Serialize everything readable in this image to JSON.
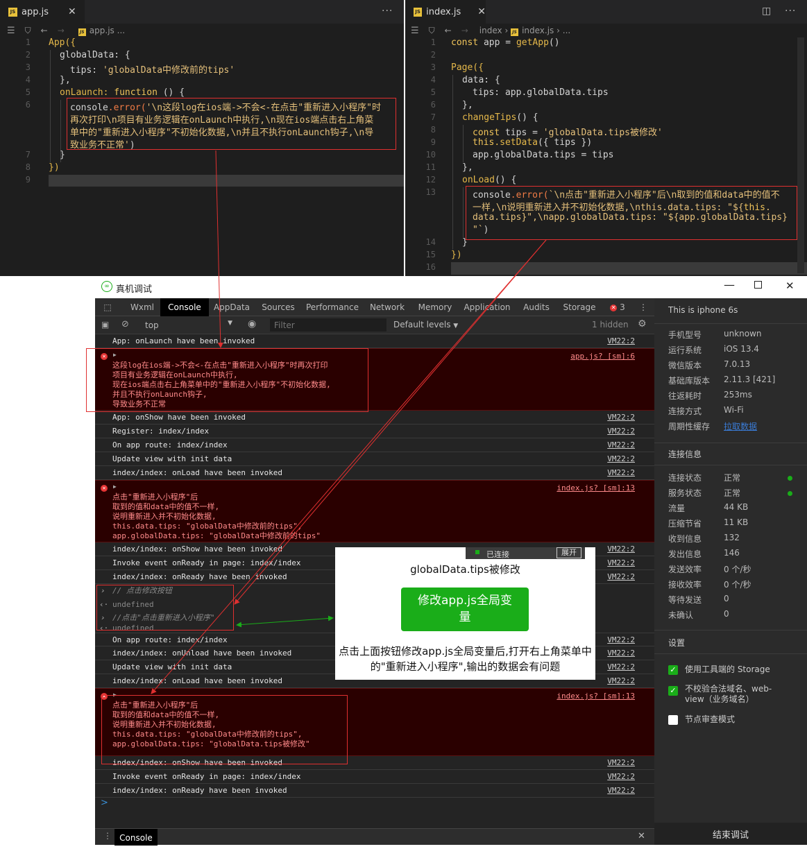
{
  "editor_left": {
    "tab": "app.js",
    "file_icon": "JS",
    "more": "···",
    "breadcrumb": [
      "app.js",
      "..."
    ],
    "line_numbers": [
      "1",
      "2",
      "3",
      "4",
      "5",
      "6",
      "7",
      "8",
      "9"
    ],
    "code": {
      "l1a": "App({",
      "l2a": "globalData: {",
      "l3a": "tips: ",
      "l3b": "'globalData中修改前的tips'",
      "l4a": "},",
      "l5a": "onLaunch: ",
      "l5b": "function",
      "l5c": " () {",
      "l6a": "console",
      "l6b": ".error(",
      "l6c": "'\\n这段log在ios端->不会<-在点击\"重新进入小程序\"时",
      "l6d": "再次打印\\n项目有业务逻辑在onLaunch中执行,\\n现在ios端点击右上角菜",
      "l6e": "单中的\"重新进入小程序\"不初始化数据,\\n并且不执行onLaunch钩子,\\n导",
      "l6f": "致业务不正常'",
      "l6g": ")",
      "l7a": "}",
      "l8a": "})"
    }
  },
  "editor_right": {
    "tab": "index.js",
    "file_icon": "JS",
    "more": "···",
    "breadcrumb": [
      "index",
      "index.js",
      "..."
    ],
    "line_numbers": [
      "1",
      "2",
      "3",
      "4",
      "5",
      "6",
      "7",
      "8",
      "9",
      "10",
      "11",
      "12",
      "13",
      "14",
      "15",
      "16"
    ],
    "code": {
      "l1a": "const",
      "l1b": " app = ",
      "l1c": "getApp",
      "l1d": "()",
      "l3a": "Page({",
      "l4a": "data: {",
      "l5a": "tips: app.globalData.tips",
      "l6a": "},",
      "l7a": "changeTips",
      "l7b": "() {",
      "l8a": "const",
      "l8b": " tips = ",
      "l8c": "'globalData.tips被修改'",
      "l9a": "this",
      "l9b": ".setData",
      "l9c": "({ tips })",
      "l10a": "app.globalData.tips = tips",
      "l11a": "},",
      "l12a": "onLoad",
      "l12b": "() {",
      "l13a": "console",
      "l13b": ".error(",
      "l13c": "`\\n点击\"重新进入小程序\"后\\n取到的值和data中的值不",
      "l13d": "一样,\\n说明重新进入并不初始化数据,\\nthis.data.tips: \"${",
      "l13e": "this",
      "l13f": ".",
      "l13g": "data.tips}\",\\napp.globalData.tips: \"${app.globalData.tips}",
      "l13h": "\"`",
      "l13i": ")",
      "l14a": "}",
      "l15a": "})"
    }
  },
  "debugger": {
    "title": "真机调试",
    "tabs": [
      "Wxml",
      "Console",
      "AppData",
      "Sources",
      "Performance",
      "Network",
      "Memory",
      "Application",
      "Audits",
      "Storage"
    ],
    "error_count": "3",
    "context": "top",
    "filter_placeholder": "Filter",
    "levels": "Default levels",
    "hidden": "1 hidden",
    "logs": {
      "r1": "App: onLaunch have been invoked",
      "r1s": "VM22:2",
      "e1s": "app.js? [sm]:6",
      "e1": "这段log在ios端->不会<-在点击\"重新进入小程序\"时再次打印\n项目有业务逻辑在onLaunch中执行,\n现在ios端点击右上角菜单中的\"重新进入小程序\"不初始化数据,\n并且不执行onLaunch钩子,\n导致业务不正常",
      "r2": "App: onShow have been invoked",
      "r3": "Register: index/index",
      "r4": "On app route: index/index",
      "r5": "Update view with init data",
      "r6": "index/index: onLoad have been invoked",
      "e2s": "index.js? [sm]:13",
      "e2": "点击\"重新进入小程序\"后\n取到的值和data中的值不一样,\n说明重新进入并不初始化数据,\nthis.data.tips: \"globalData中修改前的tips\",\napp.globalData.tips: \"globalData中修改前的tips\"",
      "r7": "index/index: onShow have been invoked",
      "r8": "Invoke event onReady in page: index/index",
      "r9": "index/index: onReady have been invoked",
      "c1": "// 点击修改按钮",
      "u1": "undefined",
      "c2": "//点击\"点击重新进入小程序\"",
      "u2": "undefined",
      "r10": "On app route: index/index",
      "r11": "index/index: onUnload have been invoked",
      "r12": "Update view with init data",
      "r13": "index/index: onLoad have been invoked",
      "e3s": "index.js? [sm]:13",
      "e3": "点击\"重新进入小程序\"后\n取到的值和data中的值不一样,\n说明重新进入并不初始化数据,\nthis.data.tips: \"globalData中修改前的tips\",\napp.globalData.tips: \"globalData.tips被修改\"",
      "r14": "index/index: onShow have been invoked",
      "r15": "Invoke event onReady in page: index/index",
      "r16": "index/index: onReady have been invoked"
    },
    "vm": "VM22:2",
    "prompt": ">",
    "bottom_tab": "Console",
    "side": {
      "device": "This is iphone 6s",
      "info": [
        {
          "k": "手机型号",
          "v": "unknown"
        },
        {
          "k": "运行系统",
          "v": "iOS 13.4"
        },
        {
          "k": "微信版本",
          "v": "7.0.13"
        },
        {
          "k": "基础库版本",
          "v": "2.11.3 [421]"
        },
        {
          "k": "往返耗时",
          "v": "253ms"
        },
        {
          "k": "连接方式",
          "v": "Wi-Fi"
        },
        {
          "k": "周期性缓存",
          "v": "拉取数据"
        }
      ],
      "conn_title": "连接信息",
      "conn": [
        {
          "k": "连接状态",
          "v": "正常"
        },
        {
          "k": "服务状态",
          "v": "正常"
        },
        {
          "k": "流量",
          "v": "44 KB"
        },
        {
          "k": "压缩节省",
          "v": "11 KB"
        },
        {
          "k": "收到信息",
          "v": "132"
        },
        {
          "k": "发出信息",
          "v": "146"
        },
        {
          "k": "发送效率",
          "v": "0 个/秒"
        },
        {
          "k": "接收效率",
          "v": "0 个/秒"
        },
        {
          "k": "等待发送",
          "v": "0"
        },
        {
          "k": "未确认",
          "v": "0"
        }
      ],
      "settings_title": "设置",
      "settings": [
        {
          "label": "使用工具端的 Storage",
          "checked": true
        },
        {
          "label": "不校验合法域名、web-view（业务域名）",
          "checked": true
        },
        {
          "label": "节点审查模式",
          "checked": false
        }
      ],
      "end_button": "结束调试"
    }
  },
  "phone": {
    "status": "已连接",
    "expand": "展开",
    "title": "globalData.tips被修改",
    "button": "修改app.js全局变量",
    "note": "点击上面按钮修改app.js全局变量后,打开右上角菜单中的\"重新进入小程序\",输出的数据会有问题"
  },
  "colors": {
    "annotation_red": "#e03030",
    "annotation_green": "#1aad19",
    "accent": "#1aad19"
  }
}
